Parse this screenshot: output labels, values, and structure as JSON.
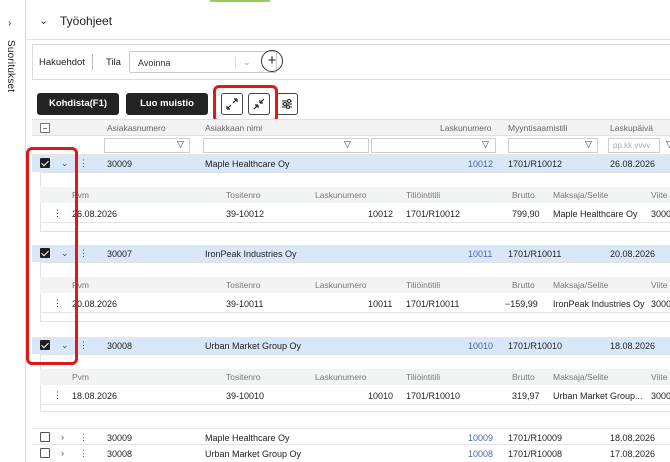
{
  "sidebar": {
    "expand_icon": "chevron-right-icon",
    "label": "Suoritukset"
  },
  "header": {
    "title": "Työohjeet",
    "collapse_icon": "chevron-down-icon"
  },
  "filters": {
    "label": "Hakuehdot",
    "state_label": "Tila",
    "state_value": "Avoinna",
    "add_icon": "plus-circle-icon"
  },
  "toolbar": {
    "allocate_label": "Kohdista(F1)",
    "memo_label": "Luo muistio",
    "expand_icon": "expand-arrows-icon",
    "collapse_icon": "collapse-arrows-icon",
    "settings_icon": "sliders-icon"
  },
  "columns": [
    "Asiakasnumero",
    "Asiakkaan nimi",
    "Laskunumero",
    "Myyntisaamistili",
    "Laskupäivä"
  ],
  "filter_row": {
    "date_placeholder": "pp.kk.vvvv"
  },
  "sub_columns": [
    "Pvm",
    "Tositenro",
    "Laskunumero",
    "Tiliöintitili",
    "Brutto",
    "Maksaja/Selite",
    "Viite"
  ],
  "expanded_rows": [
    {
      "customer_no": "30009",
      "customer": "Maple Healthcare Oy",
      "invoice": "10012",
      "account": "1701/R10012",
      "date": "26.08.2026",
      "sub": {
        "pvm": "26.08.2026",
        "tosite": "39-10012",
        "lasku": "10012",
        "tili": "1701/R10012",
        "brutto": "799,90",
        "maksaja": "Maple Healthcare Oy",
        "viite": "3000"
      }
    },
    {
      "customer_no": "30007",
      "customer": "IronPeak Industries Oy",
      "invoice": "10011",
      "account": "1701/R10011",
      "date": "20.08.2026",
      "sub": {
        "pvm": "20.08.2026",
        "tosite": "39-10011",
        "lasku": "10011",
        "tili": "1701/R10011",
        "brutto": "−159,99",
        "maksaja": "IronPeak Industries Oy",
        "viite": "3000"
      }
    },
    {
      "customer_no": "30008",
      "customer": "Urban Market Group Oy",
      "invoice": "10010",
      "account": "1701/R10010",
      "date": "18.08.2026",
      "sub": {
        "pvm": "18.08.2026",
        "tosite": "39-10010",
        "lasku": "10010",
        "tili": "1701/R10010",
        "brutto": "319,97",
        "maksaja": "Urban Market Group...",
        "viite": "3000"
      }
    }
  ],
  "collapsed_rows": [
    {
      "customer_no": "30009",
      "customer": "Maple Healthcare Oy",
      "invoice": "10009",
      "account": "1701/R10009",
      "date": "18.08.2026"
    },
    {
      "customer_no": "30008",
      "customer": "Urban Market Group Oy",
      "invoice": "10008",
      "account": "1701/R10008",
      "date": "17.08.2026"
    }
  ],
  "colors": {
    "selected_row": "#d9e8f8",
    "highlight": "#e01818",
    "button_dark": "#232323",
    "link": "#4567a8"
  }
}
